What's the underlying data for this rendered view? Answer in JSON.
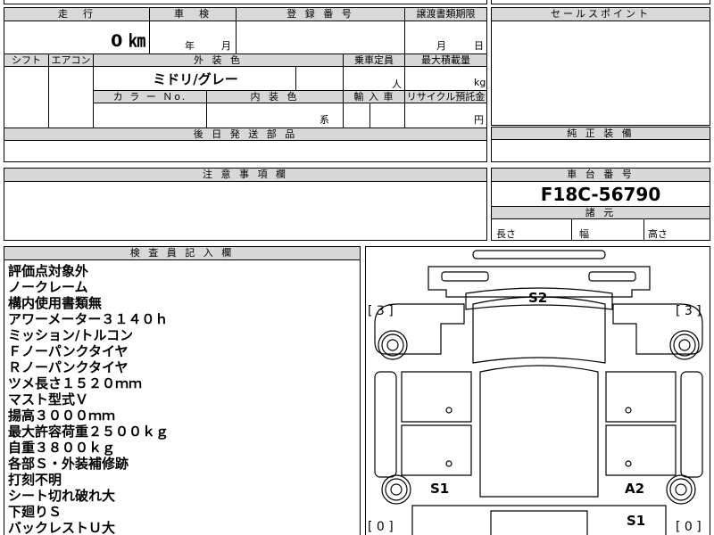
{
  "top_table": {
    "mileage_header": "走　行",
    "shaken_header": "車　検",
    "registration_header": "登 録 番 号",
    "transfer_deadline_header": "譲渡書類期限",
    "mileage_value": "0 ㎞",
    "shaken_year_unit": "年",
    "shaken_month_unit": "月",
    "transfer_month_unit": "月",
    "transfer_day_unit": "日",
    "shift_header": "シフト",
    "aircon_header": "エアコン",
    "exterior_color_header": "外 装 色",
    "capacity_header": "乗車定員",
    "max_load_header": "最大積載量",
    "exterior_color_value": "ミドリ/グレー",
    "capacity_unit": "人",
    "max_load_unit": "kg",
    "color_no_header": "カ ラ ー Ｎo.",
    "interior_color_header": "内 装 色",
    "import_header": "輸 入 車",
    "recycle_header": "リサイクル預託金",
    "interior_suffix": "系",
    "recycle_unit": "円",
    "later_parts_header": "後 日 発 送 部 品"
  },
  "sales_point": {
    "header": "セールスポイント"
  },
  "genuine_equipment": {
    "header": "純 正 装 備"
  },
  "notes": {
    "header": "注 意 事 項 欄"
  },
  "chassis": {
    "header": "車 台 番 号",
    "value": "F18C-56790",
    "dims_header": "諸 元",
    "length_label": "長さ",
    "width_label": "幅",
    "height_label": "高さ"
  },
  "inspector": {
    "header": "検 査 員 記 入 欄",
    "lines": [
      "評価点対象外",
      "ノークレーム",
      "構内使用書類無",
      "アワーメーター３１４０ｈ",
      "ミッション/トルコン",
      "Ｆノーパンクタイヤ",
      "Ｒノーパンクタイヤ",
      "ツメ長さ１５２０ｍｍ",
      "マスト型式Ｖ",
      "揚高３０００ｍｍ",
      "最大許容荷重２５００ｋｇ",
      "自重３８００ｋｇ",
      "各部Ｓ・外装補修跡",
      "打刻不明",
      "シート切れ破れ大",
      "下廻りＳ",
      "バックレストＵ大"
    ]
  },
  "diagram": {
    "label_s2": "S2",
    "label_s1_left": "S1",
    "label_a2": "A2",
    "label_s1_bottom": "S1",
    "tread_front_left": "[ 3 ]",
    "tread_front_right": "[ 3 ]",
    "tread_rear_left": "[ 0 ]",
    "tread_rear_right": "[ 0 ]"
  }
}
